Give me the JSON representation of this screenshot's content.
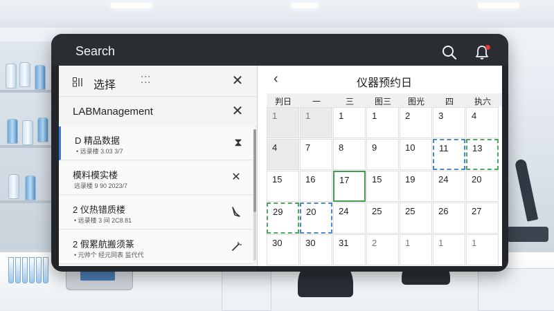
{
  "header": {
    "title": "Search",
    "notification_dot_color": "#e53935"
  },
  "left_panel": {
    "heading": "选择",
    "lab_name": "LABManagement",
    "items": [
      {
        "title": "D 精品数据",
        "subtitle": "• 远录楼 3.03 3/7",
        "action_icon": "hourglass-icon"
      },
      {
        "title": "模料模实楼",
        "subtitle": "远录楼 9 90 2023/7",
        "action_icon": "close-icon"
      },
      {
        "title": "2 仪热错质楼",
        "subtitle": "• 远录楼 3 间 2C8.81",
        "action_icon": "brush-icon"
      },
      {
        "title": "2 假累航搬须篆",
        "subtitle": "• 元帅个 经元同表 监代代",
        "action_icon": "magic-wand-icon"
      }
    ]
  },
  "calendar": {
    "title": "仪器预约日",
    "weekdays": [
      "判日",
      "一",
      "三",
      "图三",
      "图光",
      "四",
      "执六"
    ],
    "rows": [
      [
        {
          "n": "1",
          "s": "gray muted"
        },
        {
          "n": "1",
          "s": "gray muted"
        },
        {
          "n": "1",
          "s": ""
        },
        {
          "n": "1",
          "s": ""
        },
        {
          "n": "2",
          "s": ""
        },
        {
          "n": "3",
          "s": ""
        },
        {
          "n": "4",
          "s": ""
        }
      ],
      [
        {
          "n": "4",
          "s": "gray"
        },
        {
          "n": "7",
          "s": ""
        },
        {
          "n": "8",
          "s": ""
        },
        {
          "n": "9",
          "s": ""
        },
        {
          "n": "10",
          "s": ""
        },
        {
          "n": "11",
          "s": "b"
        },
        {
          "n": "13",
          "s": "g"
        }
      ],
      [
        {
          "n": "15",
          "s": ""
        },
        {
          "n": "16",
          "s": ""
        },
        {
          "n": "17",
          "s": "gs"
        },
        {
          "n": "15",
          "s": ""
        },
        {
          "n": "19",
          "s": ""
        },
        {
          "n": "24",
          "s": ""
        },
        {
          "n": "20",
          "s": ""
        }
      ],
      [
        {
          "n": "29",
          "s": "g"
        },
        {
          "n": "20",
          "s": "b"
        },
        {
          "n": "24",
          "s": ""
        },
        {
          "n": "25",
          "s": ""
        },
        {
          "n": "25",
          "s": ""
        },
        {
          "n": "26",
          "s": ""
        },
        {
          "n": "27",
          "s": ""
        }
      ],
      [
        {
          "n": "30",
          "s": ""
        },
        {
          "n": "30",
          "s": ""
        },
        {
          "n": "31",
          "s": ""
        },
        {
          "n": "2",
          "s": "muted"
        },
        {
          "n": "1",
          "s": "muted"
        },
        {
          "n": "1",
          "s": "muted"
        },
        {
          "n": "1",
          "s": "muted"
        }
      ]
    ]
  },
  "colors": {
    "accent_blue": "#3b7bd4",
    "booking_green": "#4aa85a",
    "booking_blue": "#4b86c9"
  }
}
